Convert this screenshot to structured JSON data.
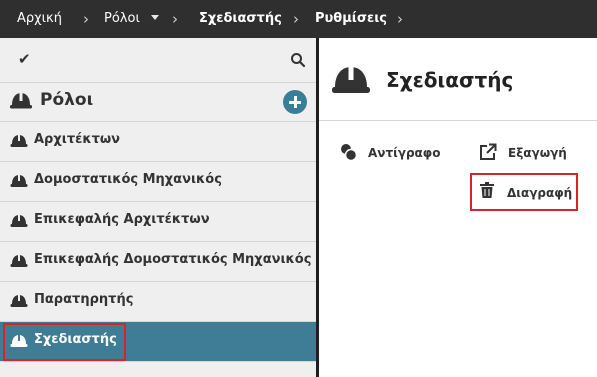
{
  "breadcrumb": {
    "items": [
      "Αρχική",
      "Ρόλοι",
      "Σχεδιαστής",
      "Ρυθμίσεις"
    ]
  },
  "sidebar": {
    "header_title": "Ρόλοι",
    "roles": [
      {
        "label": "Αρχιτέκτων"
      },
      {
        "label": "Δομοστατικός Μηχανικός"
      },
      {
        "label": "Επικεφαλής Αρχιτέκτων"
      },
      {
        "label": "Επικεφαλής Δομοστατικός Μηχανικός"
      },
      {
        "label": "Παρατηρητής"
      },
      {
        "label": "Σχεδιαστής"
      }
    ],
    "selected_index": 5
  },
  "main": {
    "title": "Σχεδιαστής",
    "actions": {
      "copy": "Αντίγραφο",
      "export": "Εξαγωγή",
      "delete": "Διαγραφή"
    }
  },
  "colors": {
    "topbar": "#2f2f2f",
    "selected": "#3f7d96",
    "accent": "#3a7d99",
    "highlight": "#d8232a"
  }
}
